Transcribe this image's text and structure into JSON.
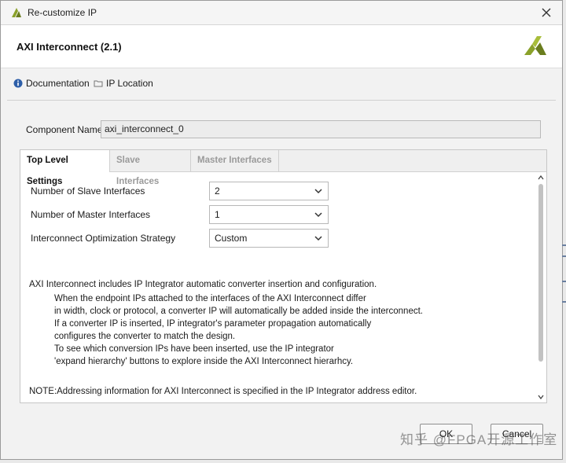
{
  "window": {
    "title": "Re-customize IP",
    "icon": "vivado-logo-icon",
    "close_icon": "close-icon"
  },
  "header": {
    "title": "AXI Interconnect (2.1)",
    "brand_icon": "xilinx-logo-icon"
  },
  "links": [
    {
      "label": "Documentation",
      "icon": "info-icon"
    },
    {
      "label": "IP Location",
      "icon": "folder-icon"
    }
  ],
  "component": {
    "label": "Component Name",
    "value": "axi_interconnect_0"
  },
  "tabs": [
    {
      "label": "Top Level Settings",
      "active": true
    },
    {
      "label": "Slave Interfaces",
      "active": false
    },
    {
      "label": "Master Interfaces",
      "active": false
    }
  ],
  "settings": [
    {
      "label": "Number of Slave Interfaces",
      "value": "2"
    },
    {
      "label": "Number of Master Interfaces",
      "value": "1"
    },
    {
      "label": "Interconnect Optimization Strategy",
      "value": "Custom"
    }
  ],
  "description": {
    "intro": "AXI Interconnect includes IP Integrator automatic converter insertion and configuration.",
    "lines": [
      "When the endpoint IPs attached to the interfaces of the AXI Interconnect differ",
      "in width, clock or protocol, a converter IP will automatically be added inside the interconnect.",
      "If a converter IP is inserted, IP integrator's parameter propagation automatically",
      "configures the converter to match the design.",
      "To see which conversion IPs have been inserted, use the IP integrator",
      "'expand hierarchy' buttons to explore inside the AXI Interconnect hierarhcy."
    ],
    "note": "NOTE:Addressing information for AXI Interconnect is specified in the IP Integrator address editor."
  },
  "buttons": {
    "ok": "OK",
    "cancel": "Cancel"
  },
  "watermark": "知乎 @FPGA开源工作室",
  "colors": {
    "xilinx_green": "#8aa12a",
    "xilinx_dark": "#6a7d1e",
    "info_blue": "#2d5ea8"
  }
}
